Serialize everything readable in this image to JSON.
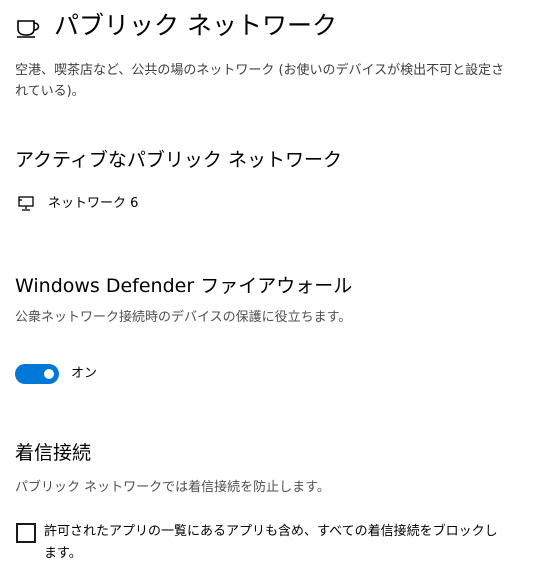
{
  "header": {
    "icon": "coffee-cup-icon",
    "title": "パブリック ネットワーク",
    "description": "空港、喫茶店など、公共の場のネットワーク (お使いのデバイスが検出不可と設定されている)。"
  },
  "active_network": {
    "title": "アクティブなパブリック ネットワーク",
    "icon": "network-computer-icon",
    "name": "ネットワーク 6"
  },
  "firewall": {
    "title": "Windows Defender ファイアウォール",
    "description": "公衆ネットワーク接続時のデバイスの保護に役立ちます。",
    "toggle_state": "on",
    "toggle_label": "オン",
    "accent_color": "#0078d7"
  },
  "incoming": {
    "title": "着信接続",
    "description": "パブリック ネットワークでは着信接続を防止します。",
    "checkbox_checked": false,
    "checkbox_label": "許可されたアプリの一覧にあるアプリも含め、すべての着信接続をブロックします。"
  }
}
